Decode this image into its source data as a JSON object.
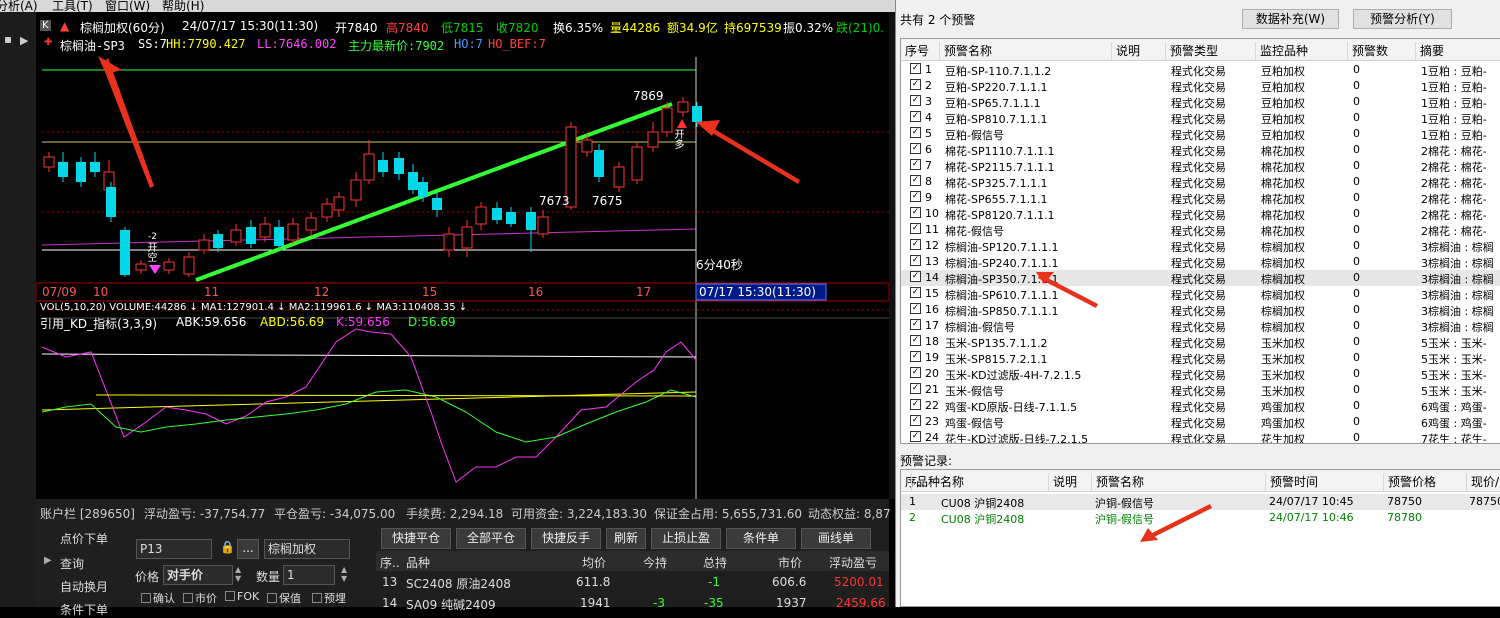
{
  "menu": [
    "分析(A)",
    "工具(T)",
    "窗口(W)",
    "帮助(H)"
  ],
  "ticker": {
    "name": "棕榈加权(60分)",
    "datetime": "24/07/17 15:30(11:30)",
    "open": "开7840",
    "high": "高7840",
    "low": "低7815",
    "close": "收7820",
    "change": "换6.35%",
    "volume": "量44286",
    "amount": "额34.9亿",
    "hold": "持697539",
    "amplitude": "振0.32%",
    "tail": "跌(21)0."
  },
  "indicator_line": {
    "name": "棕榈油-SP3",
    "ss": "SS:7",
    "hh": "HH:7790.427",
    "ll": "LL:7646.002",
    "zl": "主力最新价:7902",
    "ho": "HO:7",
    "ho_bef": "HO_BEF:7"
  },
  "chart_labels": {
    "p7869": "7869",
    "p7673": "7673",
    "p7675": "7675",
    "time_remain": "6分40秒",
    "sig_open_long": "开多",
    "sig_open_short": "开空",
    "sig_2": "-2"
  },
  "date_axis": [
    "07/09",
    "10",
    "11",
    "12",
    "15",
    "16",
    "17"
  ],
  "cursor_time": "07/17  15:30(11:30)",
  "vol_line": "VOL(5,10,20)  VOLUME:44286 ↓ MA1:127901.4 ↓ MA2:119961.6 ↓ MA3:110408.35 ↓",
  "kd_line": {
    "name": "引用_KD_指标(3,3,9)",
    "abk": "ABK:59.656",
    "abd": "ABD:56.69",
    "k": "K:59.656",
    "d": "D:56.69"
  },
  "account": {
    "label": "账户栏 [289650]",
    "float_pl": "浮动盈亏: -37,754.77",
    "close_pl": "平仓盈亏: -34,075.00",
    "fee": "手续费: 2,294.18",
    "available": "可用资金: 3,224,183.30",
    "margin": "保证金占用: 5,655,731.60",
    "dynamic": "动态权益: 8,87"
  },
  "order_menu": [
    "点价下单",
    "查询",
    "自动换月",
    "条件下单"
  ],
  "order_form": {
    "account_code": "P13",
    "contract": "棕榈加权",
    "price_label": "价格",
    "price_value": "对手价",
    "qty_label": "数量",
    "qty_value": "1",
    "opts": [
      "确认",
      "市价",
      "FOK",
      "保值",
      "预埋"
    ]
  },
  "quick_buttons": [
    "快捷平仓",
    "全部平仓",
    "快捷反手",
    "刷新",
    "止损止盈",
    "条件单",
    "画线单"
  ],
  "positions": {
    "headers": [
      "序..",
      "品种",
      "均价",
      "今持",
      "总持",
      "市价",
      "浮动盈亏"
    ],
    "rows": [
      {
        "no": "13",
        "name": "SC2408 原油2408",
        "avg": "611.8",
        "today": "",
        "total": "-1",
        "price": "606.6",
        "pl": "5200.01"
      },
      {
        "no": "14",
        "name": "SA09 纯碱2409",
        "avg": "1941",
        "today": "-3",
        "total": "-35",
        "price": "1937",
        "pl": "2459.66"
      }
    ]
  },
  "alert_panel": {
    "summary": "共有 2 个预警",
    "btn_supplement": "数据补充(W)",
    "btn_analysis": "预警分析(Y)",
    "headers": [
      "序号",
      "预警名称",
      "说明",
      "预警类型",
      "监控品种",
      "预警数",
      "摘要"
    ],
    "rows": [
      {
        "no": "1",
        "name": "豆粕-SP-110.7.1.1.2",
        "type": "程式化交易",
        "symbol": "豆粕加权",
        "count": "0",
        "summary": "1豆粕 : 豆粕-"
      },
      {
        "no": "2",
        "name": "豆粕-SP220.7.1.1.1",
        "type": "程式化交易",
        "symbol": "豆粕加权",
        "count": "0",
        "summary": "1豆粕 : 豆粕-"
      },
      {
        "no": "3",
        "name": "豆粕-SP65.7.1.1.1",
        "type": "程式化交易",
        "symbol": "豆粕加权",
        "count": "0",
        "summary": "1豆粕 : 豆粕-"
      },
      {
        "no": "4",
        "name": "豆粕-SP810.7.1.1.1",
        "type": "程式化交易",
        "symbol": "豆粕加权",
        "count": "0",
        "summary": "1豆粕 : 豆粕-"
      },
      {
        "no": "5",
        "name": "豆粕-假信号",
        "type": "程式化交易",
        "symbol": "豆粕加权",
        "count": "0",
        "summary": "1豆粕 : 豆粕-"
      },
      {
        "no": "6",
        "name": "棉花-SP1110.7.1.1.1",
        "type": "程式化交易",
        "symbol": "棉花加权",
        "count": "0",
        "summary": "2棉花 : 棉花-"
      },
      {
        "no": "7",
        "name": "棉花-SP2115.7.1.1.1",
        "type": "程式化交易",
        "symbol": "棉花加权",
        "count": "0",
        "summary": "2棉花 : 棉花-"
      },
      {
        "no": "8",
        "name": "棉花-SP325.7.1.1.1",
        "type": "程式化交易",
        "symbol": "棉花加权",
        "count": "0",
        "summary": "2棉花 : 棉花-"
      },
      {
        "no": "9",
        "name": "棉花-SP655.7.1.1.1",
        "type": "程式化交易",
        "symbol": "棉花加权",
        "count": "0",
        "summary": "2棉花 : 棉花-"
      },
      {
        "no": "10",
        "name": "棉花-SP8120.7.1.1.1",
        "type": "程式化交易",
        "symbol": "棉花加权",
        "count": "0",
        "summary": "2棉花 : 棉花-"
      },
      {
        "no": "11",
        "name": "棉花-假信号",
        "type": "程式化交易",
        "symbol": "棉花加权",
        "count": "0",
        "summary": "2棉花 : 棉花-"
      },
      {
        "no": "12",
        "name": "棕榈油-SP120.7.1.1.1",
        "type": "程式化交易",
        "symbol": "棕榈加权",
        "count": "0",
        "summary": "3棕榈油 : 棕榈"
      },
      {
        "no": "13",
        "name": "棕榈油-SP240.7.1.1.1",
        "type": "程式化交易",
        "symbol": "棕榈加权",
        "count": "0",
        "summary": "3棕榈油 : 棕榈"
      },
      {
        "no": "14",
        "name": "棕榈油-SP350.7.1.1.1",
        "type": "程式化交易",
        "symbol": "棕榈加权",
        "count": "0",
        "summary": "3棕榈油 : 棕榈"
      },
      {
        "no": "15",
        "name": "棕榈油-SP610.7.1.1.1",
        "type": "程式化交易",
        "symbol": "棕榈加权",
        "count": "0",
        "summary": "3棕榈油 : 棕榈"
      },
      {
        "no": "16",
        "name": "棕榈油-SP850.7.1.1.1",
        "type": "程式化交易",
        "symbol": "棕榈加权",
        "count": "0",
        "summary": "3棕榈油 : 棕榈"
      },
      {
        "no": "17",
        "name": "棕榈油-假信号",
        "type": "程式化交易",
        "symbol": "棕榈加权",
        "count": "0",
        "summary": "3棕榈油 : 棕榈"
      },
      {
        "no": "18",
        "name": "玉米-SP135.7.1.1.2",
        "type": "程式化交易",
        "symbol": "玉米加权",
        "count": "0",
        "summary": "5玉米 : 玉米-"
      },
      {
        "no": "19",
        "name": "玉米-SP815.7.2.1.1",
        "type": "程式化交易",
        "symbol": "玉米加权",
        "count": "0",
        "summary": "5玉米 : 玉米-"
      },
      {
        "no": "20",
        "name": "玉米-KD过滤版-4H-7.2.1.5",
        "type": "程式化交易",
        "symbol": "玉米加权",
        "count": "0",
        "summary": "5玉米 : 玉米-"
      },
      {
        "no": "21",
        "name": "玉米-假信号",
        "type": "程式化交易",
        "symbol": "玉米加权",
        "count": "0",
        "summary": "5玉米 : 玉米-"
      },
      {
        "no": "22",
        "name": "鸡蛋-KD原版-日线-7.1.1.5",
        "type": "程式化交易",
        "symbol": "鸡蛋加权",
        "count": "0",
        "summary": "6鸡蛋 : 鸡蛋-"
      },
      {
        "no": "23",
        "name": "鸡蛋-假信号",
        "type": "程式化交易",
        "symbol": "鸡蛋加权",
        "count": "0",
        "summary": "6鸡蛋 : 鸡蛋-"
      },
      {
        "no": "24",
        "name": "花生-KD过滤版-日线-7.2.1.5",
        "type": "程式化交易",
        "symbol": "花生加权",
        "count": "0",
        "summary": "7花生 : 花生-"
      }
    ]
  },
  "alert_log": {
    "title": "预警记录:",
    "headers": [
      "序...",
      "品种名称",
      "说明",
      "预警名称",
      "预警时间",
      "预警价格",
      "现价/"
    ],
    "rows": [
      {
        "no": "1",
        "symbol": "CU08 沪铜2408",
        "desc": "",
        "name": "沪铜-假信号",
        "time": "24/07/17 10:45",
        "price": "78750",
        "now": "78750"
      },
      {
        "no": "2",
        "symbol": "CU08 沪铜2408",
        "desc": "",
        "name": "沪铜-假信号",
        "time": "24/07/17 10:46",
        "price": "78780",
        "now": ""
      }
    ]
  },
  "colors": {
    "up": "#ff3333",
    "down": "#00d8e8",
    "trend": "#33ff33",
    "yellow": "#ffff00",
    "magenta": "#ff33ff",
    "blue": "#4a9cff"
  }
}
